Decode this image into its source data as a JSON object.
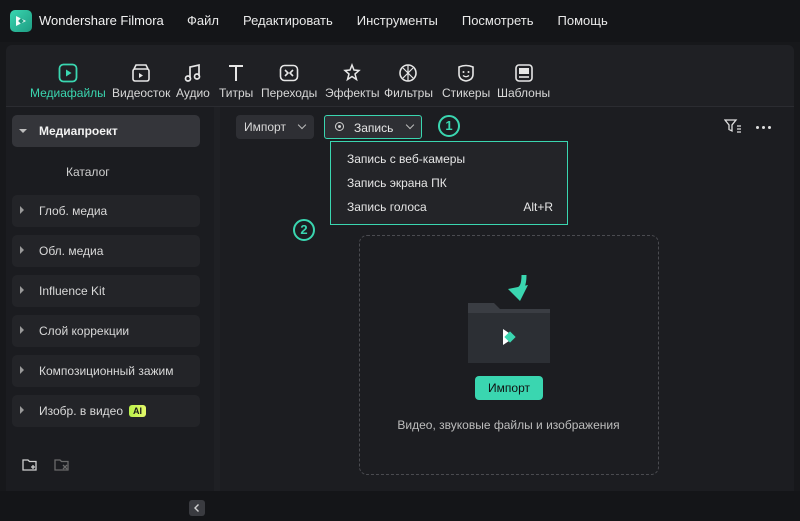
{
  "app": {
    "name": "Wondershare Filmora"
  },
  "menu": [
    "Файл",
    "Редактировать",
    "Инструменты",
    "Посмотреть",
    "Помощь"
  ],
  "toolbar": {
    "items": [
      {
        "label": "Медиафайлы",
        "icon": "media-icon",
        "active": true
      },
      {
        "label": "Видеосток",
        "icon": "stock-icon"
      },
      {
        "label": "Аудио",
        "icon": "music-icon"
      },
      {
        "label": "Титры",
        "icon": "titles-icon"
      },
      {
        "label": "Переходы",
        "icon": "transitions-icon"
      },
      {
        "label": "Эффекты",
        "icon": "effects-icon"
      },
      {
        "label": "Фильтры",
        "icon": "filters-icon"
      },
      {
        "label": "Стикеры",
        "icon": "stickers-icon"
      },
      {
        "label": "Шаблоны",
        "icon": "templates-icon"
      }
    ]
  },
  "sidebar": {
    "project": "Медиапроект",
    "catalog": "Каталог",
    "items": [
      "Глоб. медиа",
      "Обл. медиа",
      "Influence Kit",
      "Слой коррекции",
      "Композиционный зажим",
      "Изобр. в видео"
    ],
    "ai_badge": "AI"
  },
  "content": {
    "import_button": "Импорт",
    "record_button": "Запись",
    "step1": "1",
    "step2": "2",
    "dropdown": {
      "items": [
        {
          "label": "Запись с веб-камеры",
          "shortcut": ""
        },
        {
          "label": "Запись экрана ПК",
          "shortcut": ""
        },
        {
          "label": "Запись голоса",
          "shortcut": "Alt+R"
        }
      ]
    },
    "drop_import_button": "Импорт",
    "drop_text": "Видео, звуковые файлы и изображения"
  },
  "colors": {
    "accent": "#3ad6b0",
    "background": "#1c1d21",
    "ai_badge": "#c9f45a"
  }
}
